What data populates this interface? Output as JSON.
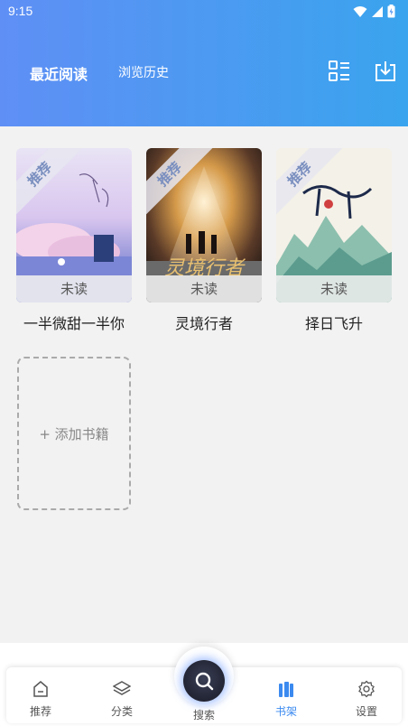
{
  "status_bar": {
    "time": "9:15",
    "icons": [
      "wifi-icon",
      "signal-icon",
      "battery-icon"
    ]
  },
  "header": {
    "tabs": [
      {
        "label": "最近阅读",
        "active": true
      },
      {
        "label": "浏览历史",
        "active": false
      }
    ],
    "actions": [
      "grid-icon",
      "download-icon"
    ]
  },
  "books": [
    {
      "title": "一半微甜一半你",
      "badge": "推荐",
      "status": "未读"
    },
    {
      "title": "灵境行者",
      "badge": "推荐",
      "status": "未读"
    },
    {
      "title": "择日飞升",
      "badge": "推荐",
      "status": "未读"
    }
  ],
  "add_book": {
    "label": "+ 添加书籍"
  },
  "nav": {
    "items": [
      {
        "label": "推荐",
        "icon": "home-icon",
        "active": false
      },
      {
        "label": "分类",
        "icon": "layers-icon",
        "active": false
      },
      {
        "label": "搜索",
        "icon": "search-icon",
        "active": false
      },
      {
        "label": "书架",
        "icon": "bookshelf-icon",
        "active": true
      },
      {
        "label": "设置",
        "icon": "gear-icon",
        "active": false
      }
    ]
  },
  "colors": {
    "header_start": "#5f8ff5",
    "header_end": "#3aa4ee",
    "active_nav": "#3b8af0"
  }
}
